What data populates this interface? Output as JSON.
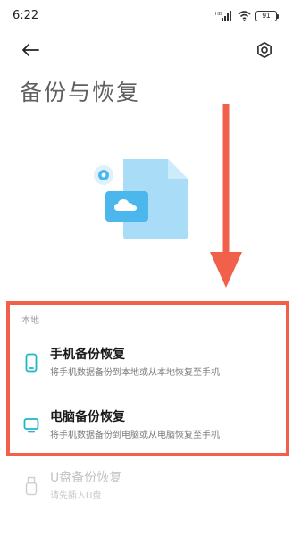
{
  "status_bar": {
    "time": "6:22",
    "battery": "91",
    "icons": [
      "hd-icon",
      "signal-icon",
      "wifi-icon",
      "battery-icon"
    ]
  },
  "header": {
    "back_icon": "back-arrow-icon",
    "settings_icon": "settings-icon"
  },
  "page": {
    "title": "备份与恢复"
  },
  "section": {
    "label": "本地"
  },
  "options": [
    {
      "title": "手机备份恢复",
      "description": "将手机数据备份到本地或从本地恢复至手机",
      "icon": "phone-icon",
      "enabled": true
    },
    {
      "title": "电脑备份恢复",
      "description": "将手机数据备份到电脑或从电脑恢复至手机",
      "icon": "monitor-icon",
      "enabled": true
    },
    {
      "title": "U盘备份恢复",
      "description": "请先插入U盘",
      "icon": "usb-drive-icon",
      "enabled": false
    }
  ],
  "colors": {
    "accent": "#1cb8c6",
    "annotation": "#f0604a",
    "illustration_light": "#a9dcf6",
    "illustration_dark": "#4bb7ec"
  }
}
